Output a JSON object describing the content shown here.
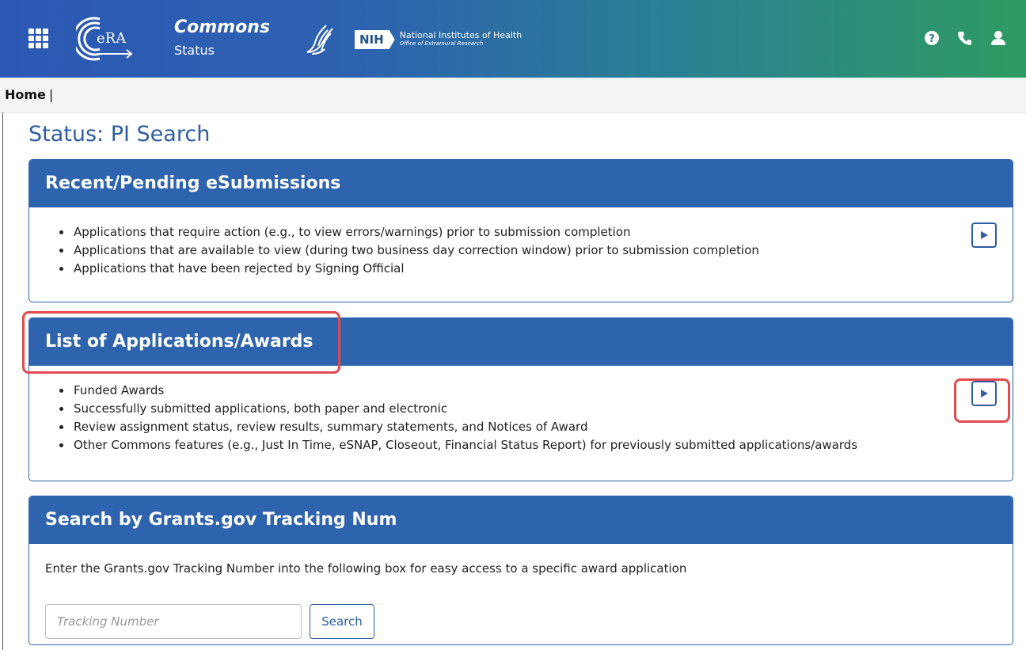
{
  "header": {
    "app_name": "Commons",
    "app_section": "Status",
    "logo_text": "eRA",
    "nih_badge": "NIH",
    "nih_name": "National Institutes of Health",
    "nih_office": "Office of Extramural Research",
    "icons": [
      "apps-grid-icon",
      "help-icon",
      "phone-icon",
      "user-icon"
    ],
    "gradient_colors": [
      "#2c58b4",
      "#2a7f94",
      "#2f9b62"
    ]
  },
  "breadcrumb": {
    "home": "Home",
    "separator": "|"
  },
  "page_title": "Status: PI Search",
  "cards": [
    {
      "title": "Recent/Pending eSubmissions",
      "items": [
        "Applications that require action (e.g., to view errors/warnings) prior to submission completion",
        "Applications that are available to view (during two business day correction window) prior to submission completion",
        "Applications that have been rejected by Signing Official"
      ]
    },
    {
      "title": "List of Applications/Awards",
      "items": [
        "Funded Awards",
        "Successfully submitted applications, both paper and electronic",
        "Review assignment status, review results, summary statements, and Notices of Award",
        "Other Commons features (e.g., Just In Time, eSNAP, Closeout, Financial Status Report) for previously submitted applications/awards"
      ]
    }
  ],
  "search_card": {
    "title": "Search by Grants.gov Tracking Num",
    "description": "Enter the Grants.gov Tracking Number into the following box for easy access to a specific award application",
    "input_value": "",
    "input_placeholder": "Tracking Number",
    "button_label": "Search"
  },
  "colors": {
    "primary": "#2e63ad",
    "title": "#2f5ea3",
    "highlight": "#e34a4f"
  }
}
